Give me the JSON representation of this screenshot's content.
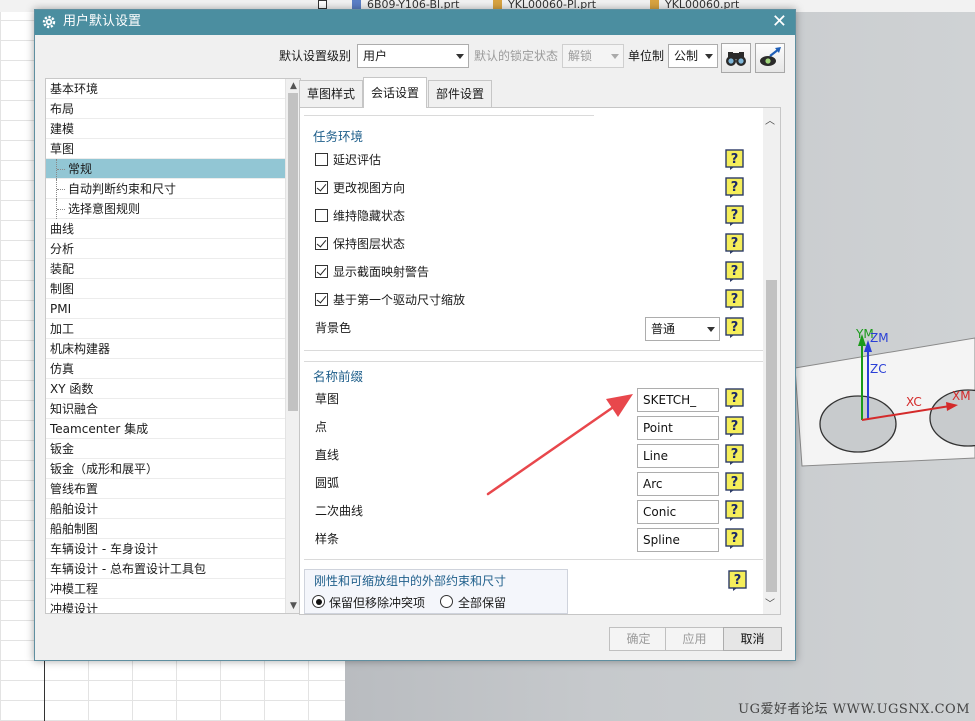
{
  "background": {
    "file_tabs": [
      "6B09-Y106-Bl.prt",
      "YKL00060-Pl.prt",
      "YKL00060.prt"
    ],
    "viewport_axes": [
      "YM",
      "ZM",
      "ZC",
      "XC",
      "XM"
    ],
    "watermark": "UG爱好者论坛  WWW.UGSNX.COM"
  },
  "dialog": {
    "title": "用户默认设置",
    "close_glyph": "✕",
    "toolbar": {
      "level_label": "默认设置级别",
      "level_value": "用户",
      "lock_label": "默认的锁定状态",
      "lock_value": "解锁",
      "unit_label": "单位制",
      "unit_value": "公制"
    },
    "tree": {
      "items": [
        {
          "label": "基本环境"
        },
        {
          "label": "布局"
        },
        {
          "label": "建模"
        },
        {
          "label": "草图"
        },
        {
          "label": "常规",
          "child": true,
          "selected": true
        },
        {
          "label": "自动判断约束和尺寸",
          "child": true
        },
        {
          "label": "选择意图规则",
          "child": true
        },
        {
          "label": "曲线"
        },
        {
          "label": "分析"
        },
        {
          "label": "装配"
        },
        {
          "label": "制图"
        },
        {
          "label": "PMI"
        },
        {
          "label": "加工"
        },
        {
          "label": "机床构建器"
        },
        {
          "label": "仿真"
        },
        {
          "label": "XY 函数"
        },
        {
          "label": "知识融合"
        },
        {
          "label": "Teamcenter 集成"
        },
        {
          "label": "钣金"
        },
        {
          "label": "钣金（成形和展平）"
        },
        {
          "label": "管线布置"
        },
        {
          "label": "船舶设计"
        },
        {
          "label": "船舶制图"
        },
        {
          "label": "车辆设计 - 车身设计"
        },
        {
          "label": "车辆设计 - 总布置设计工具包"
        },
        {
          "label": "冲模工程"
        },
        {
          "label": "冲模设计"
        }
      ]
    },
    "tabs": [
      {
        "label": "草图样式"
      },
      {
        "label": "会话设置",
        "active": true
      },
      {
        "label": "部件设置"
      }
    ],
    "task_env": {
      "title": "任务环境",
      "options": [
        {
          "label": "延迟评估",
          "checked": false
        },
        {
          "label": "更改视图方向",
          "checked": true
        },
        {
          "label": "维持隐藏状态",
          "checked": false
        },
        {
          "label": "保持图层状态",
          "checked": true
        },
        {
          "label": "显示截面映射警告",
          "checked": true
        },
        {
          "label": "基于第一个驱动尺寸缩放",
          "checked": true
        }
      ],
      "bg_color_label": "背景色",
      "bg_color_value": "普通"
    },
    "name_prefix": {
      "title": "名称前缀",
      "rows": [
        {
          "label": "草图",
          "value": "SKETCH_"
        },
        {
          "label": "点",
          "value": "Point"
        },
        {
          "label": "直线",
          "value": "Line"
        },
        {
          "label": "圆弧",
          "value": "Arc"
        },
        {
          "label": "二次曲线",
          "value": "Conic"
        },
        {
          "label": "样条",
          "value": "Spline"
        }
      ]
    },
    "rigid_group": {
      "title": "刚性和可缩放组中的外部约束和尺寸",
      "options": [
        {
          "label": "保留但移除冲突项",
          "selected": true
        },
        {
          "label": "全部保留",
          "selected": false
        }
      ]
    },
    "buttons": {
      "ok": "确定",
      "apply": "应用",
      "cancel": "取消"
    }
  },
  "colors": {
    "titlebar": "#4b8ea0",
    "selection": "#92c6d4",
    "section_title": "#1f5f8b",
    "annotation_arrow": "#e8474c"
  }
}
